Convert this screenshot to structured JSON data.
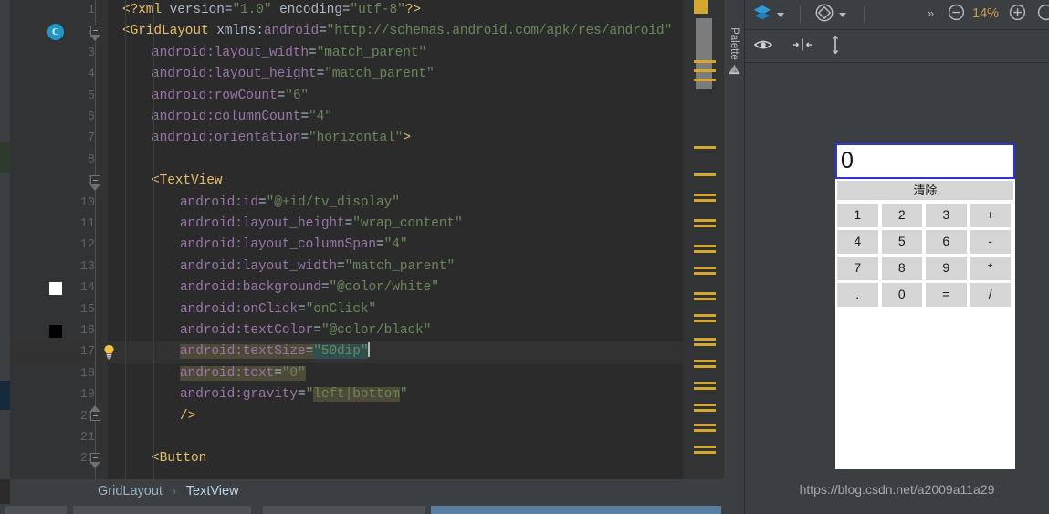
{
  "app": {
    "theme": "darcula"
  },
  "editor": {
    "language": "xml",
    "lines": [
      {
        "n": "1",
        "indent": 0,
        "tokens": [
          {
            "t": "<?xml ",
            "c": "c-tag"
          },
          {
            "t": "version",
            "c": "c-plain"
          },
          {
            "t": "=",
            "c": "c-punc"
          },
          {
            "t": "\"1.0\"",
            "c": "c-str"
          },
          {
            "t": " encoding",
            "c": "c-plain"
          },
          {
            "t": "=",
            "c": "c-punc"
          },
          {
            "t": "\"utf-8\"",
            "c": "c-str"
          },
          {
            "t": "?>",
            "c": "c-tag"
          }
        ]
      },
      {
        "n": "2",
        "indent": 0,
        "tokens": [
          {
            "t": "<GridLayout",
            "c": "c-tag"
          },
          {
            "t": " xmlns:",
            "c": "c-plain"
          },
          {
            "t": "android",
            "c": "c-attr"
          },
          {
            "t": "=",
            "c": "c-punc"
          },
          {
            "t": "\"http://schemas.android.com/apk/res/android\"",
            "c": "c-str"
          }
        ]
      },
      {
        "n": "3",
        "indent": 1,
        "tokens": [
          {
            "t": "android:layout_width",
            "c": "c-attr"
          },
          {
            "t": "=",
            "c": "c-punc"
          },
          {
            "t": "\"match_parent\"",
            "c": "c-str"
          }
        ]
      },
      {
        "n": "4",
        "indent": 1,
        "tokens": [
          {
            "t": "android:layout_height",
            "c": "c-attr"
          },
          {
            "t": "=",
            "c": "c-punc"
          },
          {
            "t": "\"match_parent\"",
            "c": "c-str"
          }
        ]
      },
      {
        "n": "5",
        "indent": 1,
        "tokens": [
          {
            "t": "android:rowCount",
            "c": "c-attr"
          },
          {
            "t": "=",
            "c": "c-punc"
          },
          {
            "t": "\"6\"",
            "c": "c-str"
          }
        ]
      },
      {
        "n": "6",
        "indent": 1,
        "tokens": [
          {
            "t": "android:columnCount",
            "c": "c-attr"
          },
          {
            "t": "=",
            "c": "c-punc"
          },
          {
            "t": "\"4\"",
            "c": "c-str"
          }
        ]
      },
      {
        "n": "7",
        "indent": 1,
        "tokens": [
          {
            "t": "android:orientation",
            "c": "c-attr"
          },
          {
            "t": "=",
            "c": "c-punc"
          },
          {
            "t": "\"horizontal\"",
            "c": "c-str"
          },
          {
            "t": ">",
            "c": "c-tag"
          }
        ]
      },
      {
        "n": "8",
        "indent": 0,
        "tokens": []
      },
      {
        "n": "9",
        "indent": 1,
        "tokens": [
          {
            "t": "<TextView",
            "c": "c-tag"
          }
        ]
      },
      {
        "n": "10",
        "indent": 2,
        "tokens": [
          {
            "t": "android:id",
            "c": "c-attr"
          },
          {
            "t": "=",
            "c": "c-punc"
          },
          {
            "t": "\"@+id/tv_display\"",
            "c": "c-str"
          }
        ]
      },
      {
        "n": "11",
        "indent": 2,
        "tokens": [
          {
            "t": "android:layout_height",
            "c": "c-attr"
          },
          {
            "t": "=",
            "c": "c-punc"
          },
          {
            "t": "\"wrap_content\"",
            "c": "c-str"
          }
        ]
      },
      {
        "n": "12",
        "indent": 2,
        "tokens": [
          {
            "t": "android:layout_columnSpan",
            "c": "c-attr"
          },
          {
            "t": "=",
            "c": "c-punc"
          },
          {
            "t": "\"4\"",
            "c": "c-str"
          }
        ]
      },
      {
        "n": "13",
        "indent": 2,
        "tokens": [
          {
            "t": "android:layout_width",
            "c": "c-attr"
          },
          {
            "t": "=",
            "c": "c-punc"
          },
          {
            "t": "\"match_parent\"",
            "c": "c-str"
          }
        ]
      },
      {
        "n": "14",
        "indent": 2,
        "tokens": [
          {
            "t": "android:background",
            "c": "c-attr"
          },
          {
            "t": "=",
            "c": "c-punc"
          },
          {
            "t": "\"@color/white\"",
            "c": "c-str"
          }
        ]
      },
      {
        "n": "15",
        "indent": 2,
        "tokens": [
          {
            "t": "android:onClick",
            "c": "c-attr"
          },
          {
            "t": "=",
            "c": "c-punc"
          },
          {
            "t": "\"onClick\"",
            "c": "c-str"
          }
        ]
      },
      {
        "n": "16",
        "indent": 2,
        "tokens": [
          {
            "t": "android:textColor",
            "c": "c-attr"
          },
          {
            "t": "=",
            "c": "c-punc"
          },
          {
            "t": "\"@color/black\"",
            "c": "c-str"
          }
        ]
      },
      {
        "n": "17",
        "indent": 2,
        "current": true,
        "tokens": [
          {
            "t": "android:textSize",
            "c": "c-attr",
            "hl": "ident"
          },
          {
            "t": "=",
            "c": "c-punc",
            "hl": "ident"
          },
          {
            "t": "\"",
            "c": "c-q",
            "hl": "sel2"
          },
          {
            "t": "50dip",
            "c": "c-str",
            "hl": "sel2"
          },
          {
            "t": "\"",
            "c": "c-q",
            "hl": "sel2"
          },
          {
            "t": "|",
            "c": "caret"
          }
        ]
      },
      {
        "n": "18",
        "indent": 2,
        "tokens": [
          {
            "t": "android:text",
            "c": "c-attr",
            "hl": "ident"
          },
          {
            "t": "=",
            "c": "c-punc",
            "hl": "ident"
          },
          {
            "t": "\"0\"",
            "c": "c-str",
            "hl": "ident"
          }
        ]
      },
      {
        "n": "19",
        "indent": 2,
        "tokens": [
          {
            "t": "android:gravity",
            "c": "c-attr"
          },
          {
            "t": "=",
            "c": "c-punc"
          },
          {
            "t": "\"",
            "c": "c-q"
          },
          {
            "t": "left|bottom",
            "c": "c-str",
            "hl": "ident"
          },
          {
            "t": "\"",
            "c": "c-q"
          }
        ]
      },
      {
        "n": "20",
        "indent": 2,
        "tokens": [
          {
            "t": "/>",
            "c": "c-tag"
          }
        ]
      },
      {
        "n": "21",
        "indent": 0,
        "tokens": []
      },
      {
        "n": "22",
        "indent": 1,
        "tokens": [
          {
            "t": "<Button",
            "c": "c-tag"
          }
        ]
      }
    ],
    "gutter_markers": {
      "class_icon_line": "C",
      "color_swatch_white": "#ffffff",
      "color_swatch_black": "#000000",
      "intention_bulb": "lightbulb-icon"
    },
    "vcs": {
      "added_color": "#2f3a2f",
      "modified_color": "#152a3d"
    },
    "error_stripe_color": "#d6a72e"
  },
  "breadcrumb": {
    "root": "GridLayout",
    "separator": "›",
    "leaf": "TextView"
  },
  "palette": {
    "label": "Palette",
    "icon": "palette-icon"
  },
  "design_toolbar": {
    "layers_icon": "layers-icon",
    "orientation_icon": "rotate-orientation-icon",
    "overflow": "»",
    "zoom_out_icon": "zoom-out-icon",
    "zoom_level": "14%",
    "zoom_in_icon": "zoom-in-icon",
    "zoom_fit_icon": "zoom-fit-icon",
    "eye_icon": "eye-icon",
    "align_horizontal_icon": "align-horizontal-icon",
    "align_vertical_icon": "align-vertical-icon"
  },
  "preview": {
    "display_value": "0",
    "clear_label": "清除",
    "keys": [
      [
        "1",
        "2",
        "3",
        "+"
      ],
      [
        "4",
        "5",
        "6",
        "-"
      ],
      [
        "7",
        "8",
        "9",
        "*"
      ],
      [
        ".",
        "0",
        "=",
        "/"
      ]
    ],
    "display_border_color": "#2b35d8",
    "key_bg": "#d5d5d5"
  },
  "watermark": {
    "text": "https://blog.csdn.net/a2009a11a29"
  }
}
